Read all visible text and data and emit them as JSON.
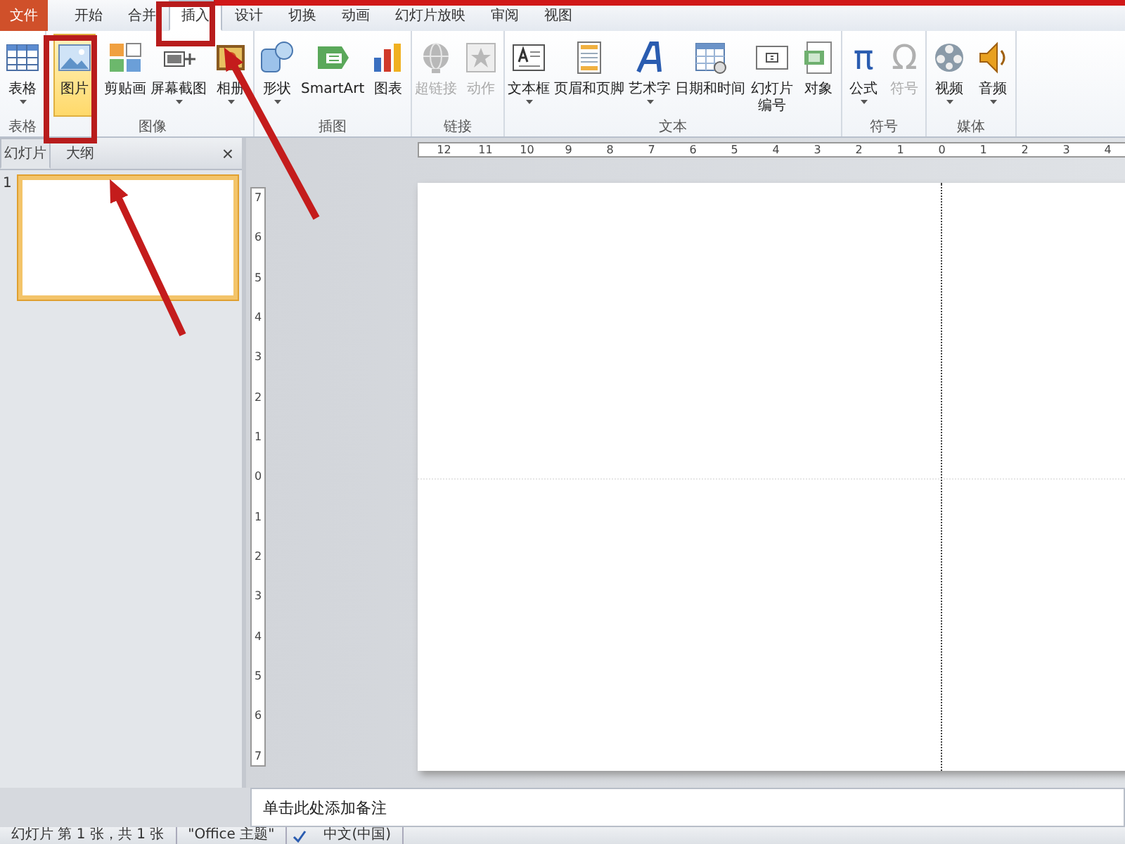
{
  "tabs": [
    {
      "label": "文件",
      "kind": "file",
      "selected": false
    },
    {
      "label": "开始",
      "kind": "tab",
      "selected": false
    },
    {
      "label": "合并",
      "kind": "tab",
      "selected": false
    },
    {
      "label": "插入",
      "kind": "tab",
      "selected": true
    },
    {
      "label": "设计",
      "kind": "tab",
      "selected": false
    },
    {
      "label": "切换",
      "kind": "tab",
      "selected": false
    },
    {
      "label": "动画",
      "kind": "tab",
      "selected": false
    },
    {
      "label": "幻灯片放映",
      "kind": "tab",
      "selected": false
    },
    {
      "label": "审阅",
      "kind": "tab",
      "selected": false
    },
    {
      "label": "视图",
      "kind": "tab",
      "selected": false
    }
  ],
  "ribbon": {
    "groups": [
      {
        "label": "表格",
        "buttons": [
          {
            "label": "表格",
            "kind": "table",
            "dropdown": true,
            "disabled": false,
            "highlighted": false
          }
        ]
      },
      {
        "label": "图像",
        "buttons": [
          {
            "label": "图片",
            "kind": "picture",
            "dropdown": false,
            "disabled": false,
            "highlighted": true
          },
          {
            "label": "剪贴画",
            "kind": "clipart",
            "dropdown": false,
            "disabled": false,
            "highlighted": false
          },
          {
            "label": "屏幕截图",
            "kind": "screenshot",
            "dropdown": true,
            "disabled": false,
            "highlighted": false
          },
          {
            "label": "相册",
            "kind": "album",
            "dropdown": true,
            "disabled": false,
            "highlighted": false
          }
        ]
      },
      {
        "label": "插图",
        "buttons": [
          {
            "label": "形状",
            "kind": "shapes",
            "dropdown": true,
            "disabled": false,
            "highlighted": false
          },
          {
            "label": "SmartArt",
            "kind": "smartart",
            "dropdown": false,
            "disabled": false,
            "highlighted": false
          },
          {
            "label": "图表",
            "kind": "chart",
            "dropdown": false,
            "disabled": false,
            "highlighted": false
          }
        ]
      },
      {
        "label": "链接",
        "buttons": [
          {
            "label": "超链接",
            "kind": "globe",
            "dropdown": false,
            "disabled": true,
            "highlighted": false
          },
          {
            "label": "动作",
            "kind": "action",
            "dropdown": false,
            "disabled": true,
            "highlighted": false
          }
        ]
      },
      {
        "label": "文本",
        "buttons": [
          {
            "label": "文本框",
            "kind": "textbox",
            "dropdown": true,
            "disabled": false,
            "highlighted": false
          },
          {
            "label": "页眉和页脚",
            "kind": "page",
            "dropdown": false,
            "disabled": false,
            "highlighted": false
          },
          {
            "label": "艺术字",
            "kind": "wordart",
            "dropdown": true,
            "disabled": false,
            "highlighted": false
          },
          {
            "label": "日期和时间",
            "kind": "calendar",
            "dropdown": false,
            "disabled": false,
            "highlighted": false
          },
          {
            "label": "幻灯片编号",
            "wrap": true,
            "kind": "slidenumber",
            "dropdown": false,
            "disabled": false,
            "highlighted": false
          },
          {
            "label": "对象",
            "kind": "object",
            "dropdown": false,
            "disabled": false,
            "highlighted": false
          }
        ]
      },
      {
        "label": "符号",
        "buttons": [
          {
            "label": "公式",
            "kind": "glyph",
            "glyph": "π",
            "dropdown": true,
            "disabled": false,
            "highlighted": false
          },
          {
            "label": "符号",
            "kind": "glyph",
            "glyph": "Ω",
            "dropdown": false,
            "disabled": true,
            "highlighted": false
          }
        ]
      },
      {
        "label": "媒体",
        "buttons": [
          {
            "label": "视频",
            "kind": "film",
            "dropdown": true,
            "disabled": false,
            "highlighted": false
          },
          {
            "label": "音频",
            "kind": "speaker",
            "dropdown": true,
            "disabled": false,
            "highlighted": false
          }
        ]
      }
    ]
  },
  "slides_pane": {
    "tabs": [
      {
        "label": "幻灯片",
        "selected": true
      },
      {
        "label": "大纲",
        "selected": false
      }
    ],
    "close": "×",
    "slides": [
      {
        "number": "1",
        "selected": true
      }
    ]
  },
  "editor": {
    "ruler_h": [
      "12",
      "11",
      "10",
      "9",
      "8",
      "7",
      "6",
      "5",
      "4",
      "3",
      "2",
      "1",
      "0",
      "1",
      "2",
      "3",
      "4"
    ],
    "ruler_v": [
      "7",
      "6",
      "5",
      "4",
      "3",
      "2",
      "1",
      "0",
      "1",
      "2",
      "3",
      "4",
      "5",
      "6",
      "7"
    ]
  },
  "notes": {
    "placeholder": "单击此处添加备注"
  },
  "status_bar": {
    "items": [
      "幻灯片 第 1 张，共 1 张",
      "\"Office 主题\"",
      "中文(中国)"
    ]
  }
}
